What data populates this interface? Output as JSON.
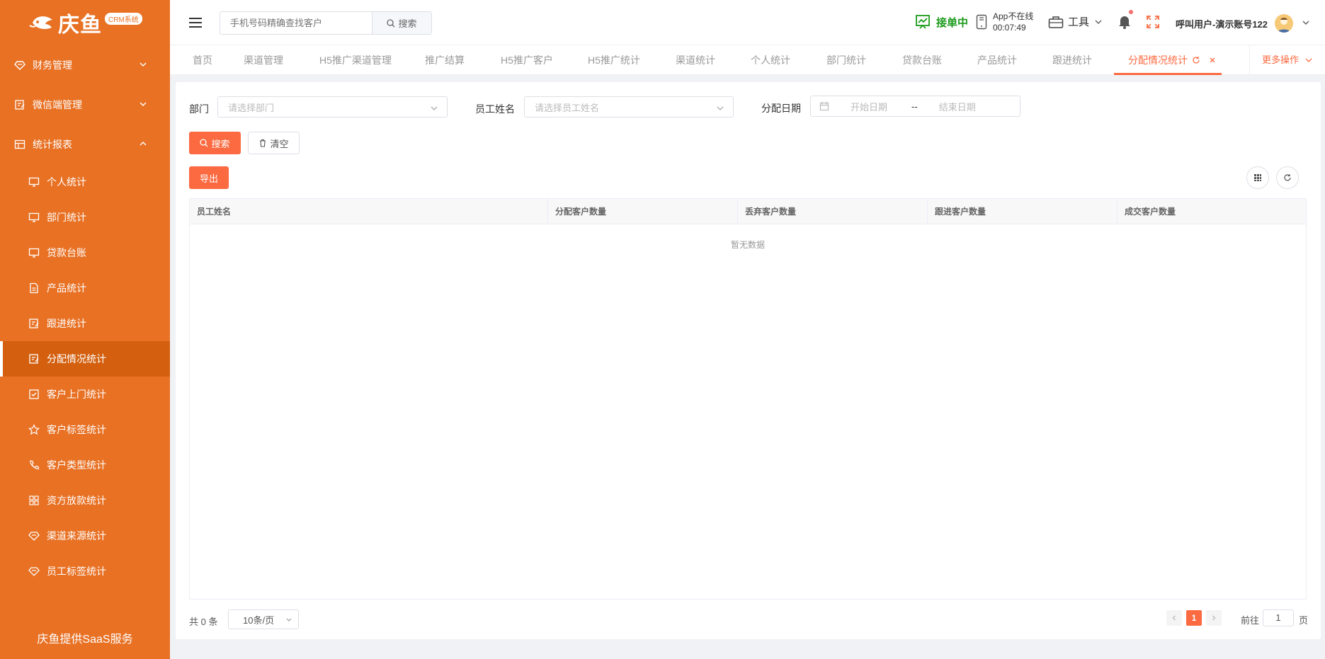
{
  "app": {
    "logo_text": "庆鱼",
    "logo_badge": "CRM系统",
    "footer_text": "庆鱼提供SaaS服务"
  },
  "sidebar": {
    "groups": [
      {
        "label": "财务管理",
        "icon": "diamond-icon",
        "expanded": false
      },
      {
        "label": "微信端管理",
        "icon": "edit-icon",
        "expanded": false
      },
      {
        "label": "统计报表",
        "icon": "table-icon",
        "expanded": true
      }
    ],
    "items": [
      {
        "label": "个人统计",
        "icon": "monitor-icon"
      },
      {
        "label": "部门统计",
        "icon": "monitor-icon"
      },
      {
        "label": "贷款台账",
        "icon": "monitor-icon"
      },
      {
        "label": "产品统计",
        "icon": "document-icon"
      },
      {
        "label": "跟进统计",
        "icon": "edit-icon"
      },
      {
        "label": "分配情况统计",
        "icon": "edit-icon",
        "active": true
      },
      {
        "label": "客户上门统计",
        "icon": "checkbox-icon"
      },
      {
        "label": "客户标签统计",
        "icon": "star-icon"
      },
      {
        "label": "客户类型统计",
        "icon": "phone-icon"
      },
      {
        "label": "资方放款统计",
        "icon": "grid-icon"
      },
      {
        "label": "渠道来源统计",
        "icon": "diamond-icon"
      },
      {
        "label": "员工标签统计",
        "icon": "diamond-icon"
      }
    ]
  },
  "header": {
    "search_placeholder": "手机号码精确查找客户",
    "search_button": "搜索",
    "status_label": "接单中",
    "app_status": "App不在线",
    "app_timer": "00:07:49",
    "tools_label": "工具",
    "user_label": "呼叫用户-演示账号122"
  },
  "tabs": {
    "items": [
      "首页",
      "渠道管理",
      "H5推广渠道管理",
      "推广结算",
      "H5推广客户",
      "H5推广统计",
      "渠道统计",
      "个人统计",
      "部门统计",
      "贷款台账",
      "产品统计",
      "跟进统计",
      "分配情况统计"
    ],
    "active_index": 12,
    "more_label": "更多操作"
  },
  "filters": {
    "department_label": "部门",
    "department_placeholder": "请选择部门",
    "employee_label": "员工姓名",
    "employee_placeholder": "请选择员工姓名",
    "date_label": "分配日期",
    "date_start_placeholder": "开始日期",
    "date_separator": "--",
    "date_end_placeholder": "结束日期",
    "search_button": "搜索",
    "clear_button": "清空",
    "export_button": "导出"
  },
  "table": {
    "columns": [
      "员工姓名",
      "分配客户数量",
      "丢弃客户数量",
      "跟进客户数量",
      "成交客户数量"
    ],
    "rows": [],
    "empty_text": "暂无数据"
  },
  "pagination": {
    "total_text": "共 0 条",
    "page_size": "10条/页",
    "current_page": "1",
    "goto_label": "前往",
    "goto_value": "1",
    "page_suffix": "页"
  },
  "colors": {
    "sidebar": "#e87124",
    "accent": "#fb6a40",
    "status_green": "#1a9a1a"
  }
}
